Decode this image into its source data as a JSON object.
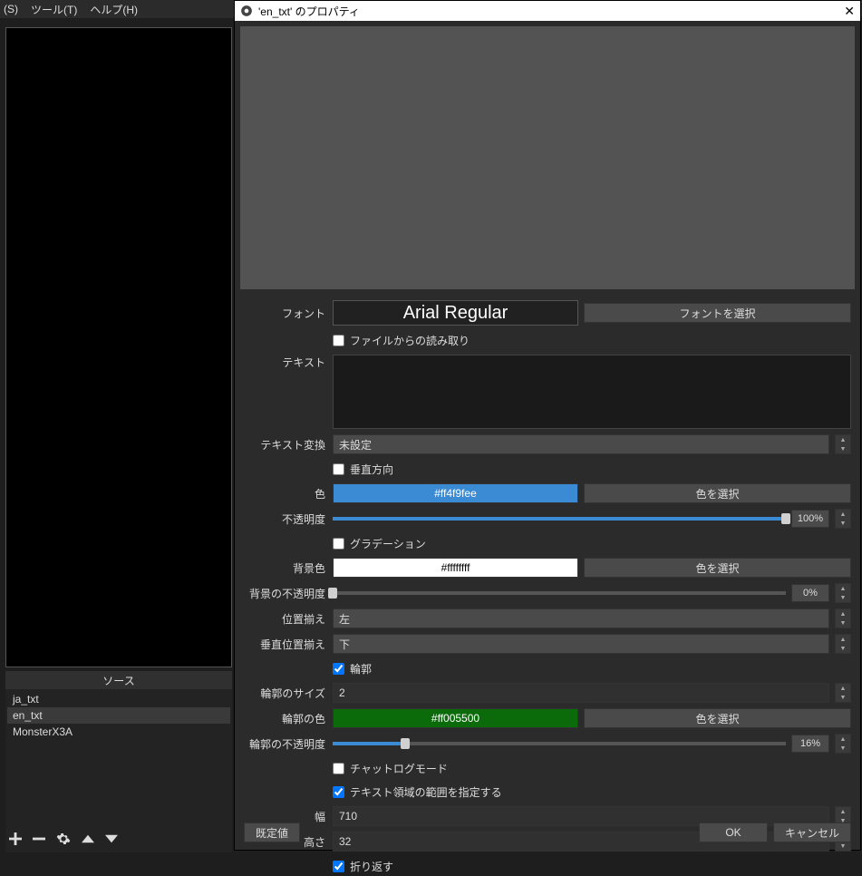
{
  "menubar": {
    "item_s": "(S)",
    "item_tools": "ツール(T)",
    "item_help": "ヘルプ(H)"
  },
  "sources": {
    "header": "ソース",
    "items": [
      "ja_txt",
      "en_txt",
      "MonsterX3A"
    ],
    "selected_index": 1
  },
  "dialog": {
    "title": "'en_txt' のプロパティ",
    "labels": {
      "font": "フォント",
      "text": "テキスト",
      "text_transform": "テキスト変換",
      "color": "色",
      "opacity": "不透明度",
      "bg_color": "背景色",
      "bg_opacity": "背景の不透明度",
      "align": "位置揃え",
      "valign": "垂直位置揃え",
      "outline_size": "輪郭のサイズ",
      "outline_color": "輪郭の色",
      "outline_opacity": "輪郭の不透明度",
      "width": "幅",
      "height": "高さ"
    },
    "font_display": "Arial Regular",
    "font_select_btn": "フォントを選択",
    "read_from_file": "ファイルからの読み取り",
    "text_value": "",
    "text_transform_value": "未設定",
    "vertical": "垂直方向",
    "color_value": "#ff4f9fee",
    "color_hex": "#3b8bd4",
    "color_select_btn": "色を選択",
    "opacity_pct": "100%",
    "opacity_fill": 100,
    "gradient": "グラデーション",
    "bg_color_value": "#ffffffff",
    "bg_color_hex": "#ffffff",
    "bg_text_color": "#000",
    "bg_opacity_pct": "0%",
    "bg_opacity_fill": 0,
    "align_value": "左",
    "valign_value": "下",
    "outline_enabled": "輪郭",
    "outline_size_value": "2",
    "outline_color_value": "#ff005500",
    "outline_color_hex": "#0b6b0b",
    "outline_opacity_pct": "16%",
    "outline_opacity_fill": 16,
    "chatlog": "チャットログモード",
    "specify_extent": "テキスト領域の範囲を指定する",
    "width_value": "710",
    "height_value": "32",
    "wrap": "折り返す",
    "defaults_btn": "既定値",
    "ok_btn": "OK",
    "cancel_btn": "キャンセル"
  }
}
